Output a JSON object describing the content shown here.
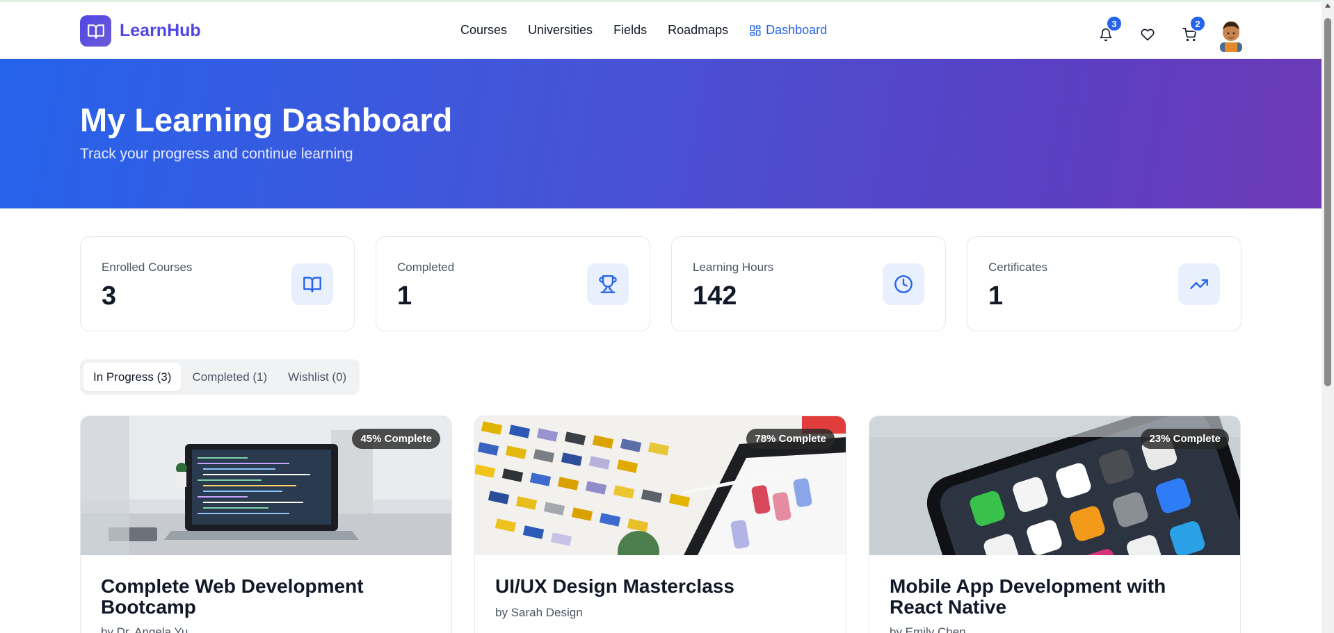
{
  "app": {
    "logo_text": "LearnHub",
    "brand_color": "#4f46e5",
    "accent_color": "#2563eb"
  },
  "nav": {
    "items": [
      {
        "label": "Courses"
      },
      {
        "label": "Universities"
      },
      {
        "label": "Fields"
      },
      {
        "label": "Roadmaps"
      },
      {
        "label": "Dashboard",
        "icon": "grid-icon",
        "active": true
      }
    ]
  },
  "header_actions": {
    "notifications_count": "3",
    "cart_count": "2",
    "icons": [
      "bell-icon",
      "heart-icon",
      "cart-icon",
      "avatar"
    ]
  },
  "hero": {
    "title": "My Learning Dashboard",
    "subtitle": "Track your progress and continue learning"
  },
  "stats": [
    {
      "label": "Enrolled Courses",
      "value": "3",
      "icon": "book-icon"
    },
    {
      "label": "Completed",
      "value": "1",
      "icon": "trophy-icon"
    },
    {
      "label": "Learning Hours",
      "value": "142",
      "icon": "clock-icon"
    },
    {
      "label": "Certificates",
      "value": "1",
      "icon": "trending-up-icon"
    }
  ],
  "tabs": [
    {
      "label": "In Progress (3)",
      "active": true
    },
    {
      "label": "Completed (1)"
    },
    {
      "label": "Wishlist (0)"
    }
  ],
  "courses": [
    {
      "title": "Complete Web Development Bootcamp",
      "author": "by Dr. Angela Yu",
      "progress_label": "45% Complete",
      "progress": 45
    },
    {
      "title": "UI/UX Design Masterclass",
      "author": "by Sarah Design",
      "progress_label": "78% Complete",
      "progress": 78
    },
    {
      "title": "Mobile App Development with React Native",
      "author": "by Emily Chen",
      "progress_label": "23% Complete",
      "progress": 23
    }
  ]
}
